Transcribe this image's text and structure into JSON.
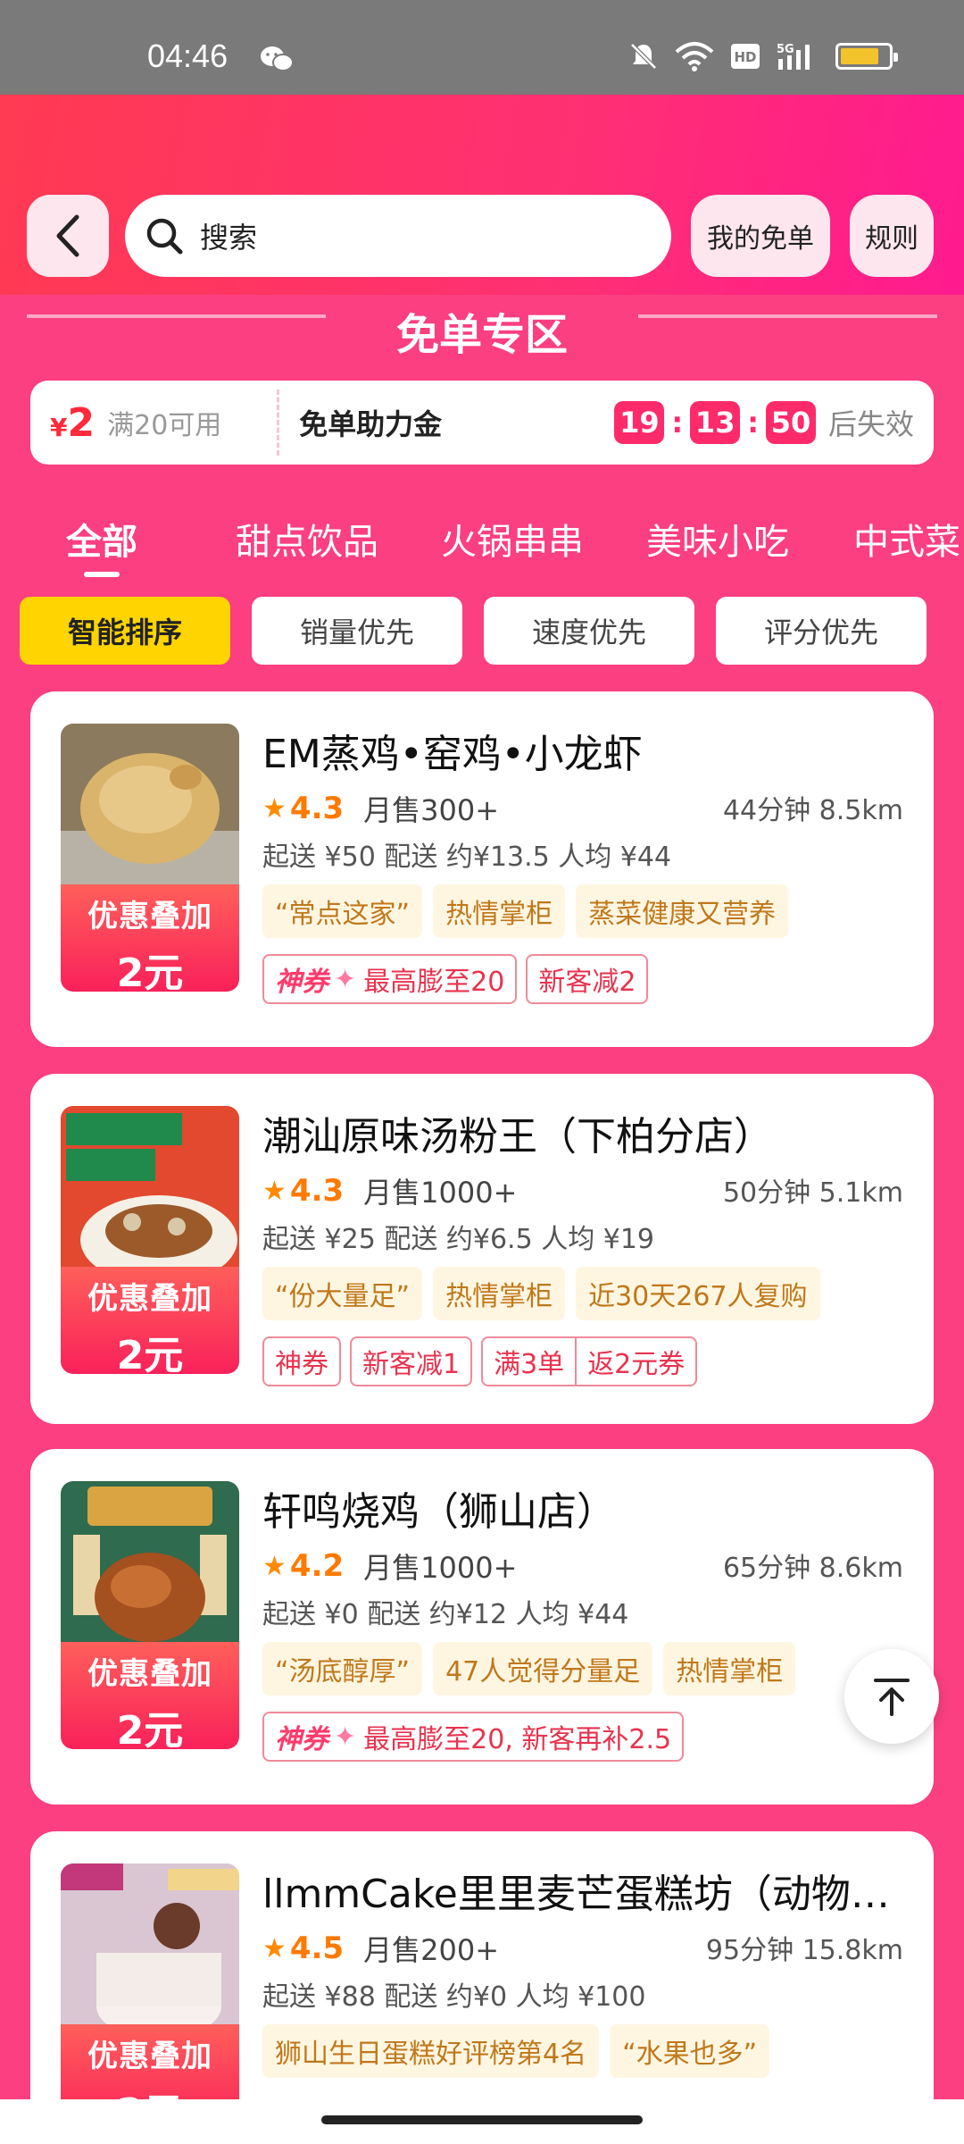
{
  "status_bar": {
    "time": "04:46",
    "icons": [
      "wechat-icon",
      "mute-icon",
      "wifi-icon",
      "hd-icon",
      "5g-signal-icon",
      "battery-icon"
    ]
  },
  "header": {
    "back_icon": "chevron-left-icon",
    "search_label": "搜索",
    "my_free_label": "我的免单",
    "rules_label": "规则"
  },
  "zone_title": "免单专区",
  "coupon": {
    "currency": "¥",
    "amount": "2",
    "condition": "满20可用",
    "name": "免单助力金",
    "timer": {
      "h": "19",
      "m": "13",
      "s": "50"
    },
    "sep": ":",
    "after": "后失效"
  },
  "categories": [
    "全部",
    "甜点饮品",
    "火锅串串",
    "美味小吃",
    "中式菜"
  ],
  "sort_options": [
    "智能排序",
    "销量优先",
    "速度优先",
    "评分优先"
  ],
  "promo": {
    "line1": "优惠叠加",
    "line2": "2元"
  },
  "stores": [
    {
      "name": "EM蒸鸡•窑鸡•小龙虾",
      "rating": "4.3",
      "monthly_sales": "月售300+",
      "eta": "44分钟 8.5km",
      "delivery": "起送 ¥50 配送 约¥13.5 人均 ¥44",
      "tags": [
        "“常点这家”",
        "热情掌柜",
        "蒸菜健康又营养"
      ],
      "coupons": {
        "shen": "神券",
        "text": "最高膨至20",
        "extra": "新客减2"
      }
    },
    {
      "name": "潮汕原味汤粉王（下柏分店）",
      "rating": "4.3",
      "monthly_sales": "月售1000+",
      "eta": "50分钟 5.1km",
      "delivery": "起送 ¥25 配送 约¥6.5 人均 ¥19",
      "tags": [
        "“份大量足”",
        "热情掌柜",
        "近30天267人复购"
      ],
      "coupons": {
        "a": "神券",
        "b": "新客减1",
        "c1": "满3单",
        "c2": "返2元券"
      }
    },
    {
      "name": "轩鸣烧鸡（狮山店）",
      "rating": "4.2",
      "monthly_sales": "月售1000+",
      "eta": "65分钟 8.6km",
      "delivery": "起送 ¥0 配送 约¥12 人均 ¥44",
      "tags": [
        "“汤底醇厚”",
        "47人觉得分量足",
        "热情掌柜"
      ],
      "coupons": {
        "shen": "神券",
        "text": "最高膨至20, 新客再补2.5"
      }
    },
    {
      "name": "llmmCake里里麦芒蛋糕坊（动物…",
      "rating": "4.5",
      "monthly_sales": "月售200+",
      "eta": "95分钟 15.8km",
      "delivery": "起送 ¥88 配送 约¥0 人均 ¥100",
      "tags": [
        "狮山生日蛋糕好评榜第4名",
        "“水果也多”"
      ]
    }
  ],
  "colors": {
    "brand_pink": "#fb3f80",
    "accent_yellow": "#ffd400",
    "timer_pink": "#ff2a6a",
    "rating_orange": "#ff7a00"
  }
}
